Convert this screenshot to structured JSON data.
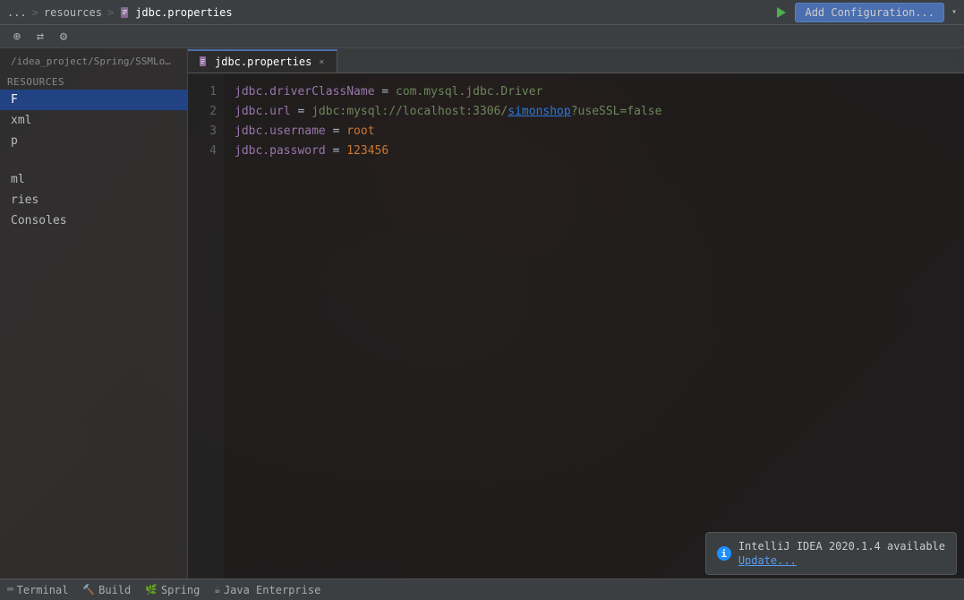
{
  "topbar": {
    "breadcrumb": {
      "part1": "...",
      "sep1": ">",
      "part2": "resources",
      "sep2": ">",
      "part3": "jdbc.properties"
    },
    "add_config_label": "Add Configuration...",
    "dropdown_arrow": "▾"
  },
  "toolbar": {
    "buttons": [
      "⊕",
      "⇄",
      "⚙"
    ]
  },
  "tabs": [
    {
      "label": "jdbc.properties",
      "active": true,
      "close": "×"
    }
  ],
  "sidebar": {
    "path": "/idea_project/Spring/SSMLogin",
    "sections": [
      {
        "label": "resources",
        "type": "section"
      },
      {
        "label": "F",
        "selected": true
      },
      {
        "label": "xml"
      },
      {
        "label": "p"
      },
      {
        "label": "ml"
      },
      {
        "label": "ries"
      },
      {
        "label": "Consoles"
      }
    ]
  },
  "code": {
    "lines": [
      {
        "num": "1",
        "key": "jdbc.driverClassName",
        "assign": " = ",
        "value": "com.mysql.jdbc.Driver"
      },
      {
        "num": "2",
        "key": "jdbc.url",
        "assign": " = ",
        "value_prefix": "jdbc:mysql://localhost:3306/",
        "value_highlight": "simonshop",
        "value_suffix": "?useSSL=false"
      },
      {
        "num": "3",
        "key": "jdbc.username",
        "assign": " = ",
        "value": "root"
      },
      {
        "num": "4",
        "key": "jdbc.password",
        "assign": " = ",
        "value": "123456"
      }
    ]
  },
  "statusbar": {
    "items": [
      {
        "icon": "⌨",
        "label": "Terminal"
      },
      {
        "icon": "🔨",
        "label": "Build"
      },
      {
        "icon": "🌿",
        "label": "Spring"
      },
      {
        "icon": "☕",
        "label": "Java Enterprise"
      }
    ]
  },
  "notification": {
    "icon": "i",
    "message": "IntelliJ IDEA 2020.1.4 available",
    "link": "Update..."
  }
}
